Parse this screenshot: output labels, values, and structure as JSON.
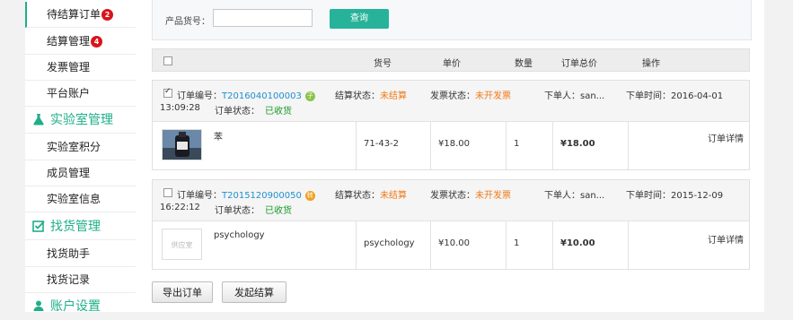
{
  "sidebar": {
    "items_top": [
      {
        "label": "待结算订单",
        "badge": "2"
      },
      {
        "label": "结算管理",
        "badge": "4"
      },
      {
        "label": "发票管理"
      },
      {
        "label": "平台账户"
      }
    ],
    "lab_section": {
      "title": "实验室管理",
      "items": [
        "实验室积分",
        "成员管理",
        "实验室信息"
      ]
    },
    "find_section": {
      "title": "找货管理",
      "items": [
        "找货助手",
        "找货记录"
      ]
    },
    "account_section": {
      "title": "账户设置"
    },
    "accent": "#1fae8a"
  },
  "search": {
    "label": "产品货号：",
    "value": "",
    "button": "查询"
  },
  "table_header": {
    "col_no": "货号",
    "col_price": "单价",
    "col_qty": "数量",
    "col_total": "订单总价",
    "col_action": "操作"
  },
  "orders": [
    {
      "checked": true,
      "order_label": "订单编号：",
      "order_no": "T2016040100003",
      "tag": "子",
      "tag_color": "#8bc34a",
      "settle_label": "结算状态：",
      "settle_status": "未结算",
      "invoice_label": "发票状态：",
      "invoice_status": "未开发票",
      "buyer_label": "下单人：",
      "buyer": "san...",
      "time_label": "下单时间：",
      "date": "2016-04-01",
      "time": "13:09:28",
      "status_label": "订单状态：",
      "status": "已收货",
      "product_name": "苯",
      "product_no": "71-43-2",
      "price": "¥18.00",
      "qty": "1",
      "total": "¥18.00",
      "action": "订单详情"
    },
    {
      "checked": false,
      "order_label": "订单编号：",
      "order_no": "T2015120900050",
      "tag": "转",
      "tag_color": "#f0a020",
      "settle_label": "结算状态：",
      "settle_status": "未结算",
      "invoice_label": "发票状态：",
      "invoice_status": "未开发票",
      "buyer_label": "下单人：",
      "buyer": "san...",
      "time_label": "下单时间：",
      "date": "2015-12-09",
      "time": "16:22:12",
      "status_label": "订单状态：",
      "status": "已收货",
      "product_name": "psychology",
      "product_no": "psychology",
      "price": "¥10.00",
      "qty": "1",
      "total": "¥10.00",
      "action": "订单详情",
      "thumb_text": "供应室"
    }
  ],
  "buttons": {
    "export": "导出订单",
    "settle": "发起结算"
  }
}
